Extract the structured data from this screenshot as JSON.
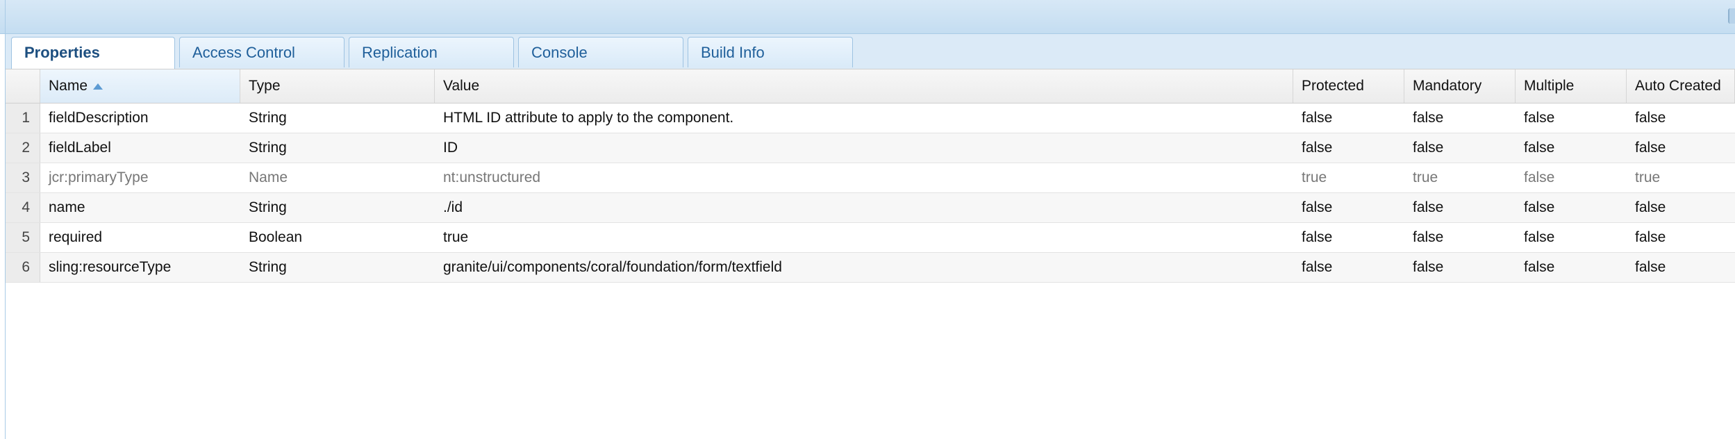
{
  "tabs": [
    {
      "label": "Properties",
      "active": true
    },
    {
      "label": "Access Control",
      "active": false
    },
    {
      "label": "Replication",
      "active": false
    },
    {
      "label": "Console",
      "active": false
    },
    {
      "label": "Build Info",
      "active": false
    }
  ],
  "table": {
    "columns": [
      "Name",
      "Type",
      "Value",
      "Protected",
      "Mandatory",
      "Multiple",
      "Auto Created"
    ],
    "sort": {
      "column": "Name",
      "direction": "ascending"
    },
    "rows": [
      {
        "num": "1",
        "name": "fieldDescription",
        "type": "String",
        "value": "HTML ID attribute to apply to the component.",
        "protected": "false",
        "mandatory": "false",
        "multiple": "false",
        "auto_created": "false"
      },
      {
        "num": "2",
        "name": "fieldLabel",
        "type": "String",
        "value": "ID",
        "protected": "false",
        "mandatory": "false",
        "multiple": "false",
        "auto_created": "false"
      },
      {
        "num": "3",
        "name": "jcr:primaryType",
        "type": "Name",
        "value": "nt:unstructured",
        "protected": "true",
        "mandatory": "true",
        "multiple": "false",
        "auto_created": "true"
      },
      {
        "num": "4",
        "name": "name",
        "type": "String",
        "value": "./id",
        "protected": "false",
        "mandatory": "false",
        "multiple": "false",
        "auto_created": "false"
      },
      {
        "num": "5",
        "name": "required",
        "type": "Boolean",
        "value": "true",
        "protected": "false",
        "mandatory": "false",
        "multiple": "false",
        "auto_created": "false"
      },
      {
        "num": "6",
        "name": "sling:resourceType",
        "type": "String",
        "value": "granite/ui/components/coral/foundation/form/textfield",
        "protected": "false",
        "mandatory": "false",
        "multiple": "false",
        "auto_created": "false"
      }
    ]
  },
  "colors": {
    "accent": "#1f5f9a",
    "tab_bg": "#dbeaf7",
    "sort_arrow": "#5d9bd3",
    "dim_text": "#777777"
  },
  "icons": {
    "sort": "sort-ascending-icon"
  }
}
